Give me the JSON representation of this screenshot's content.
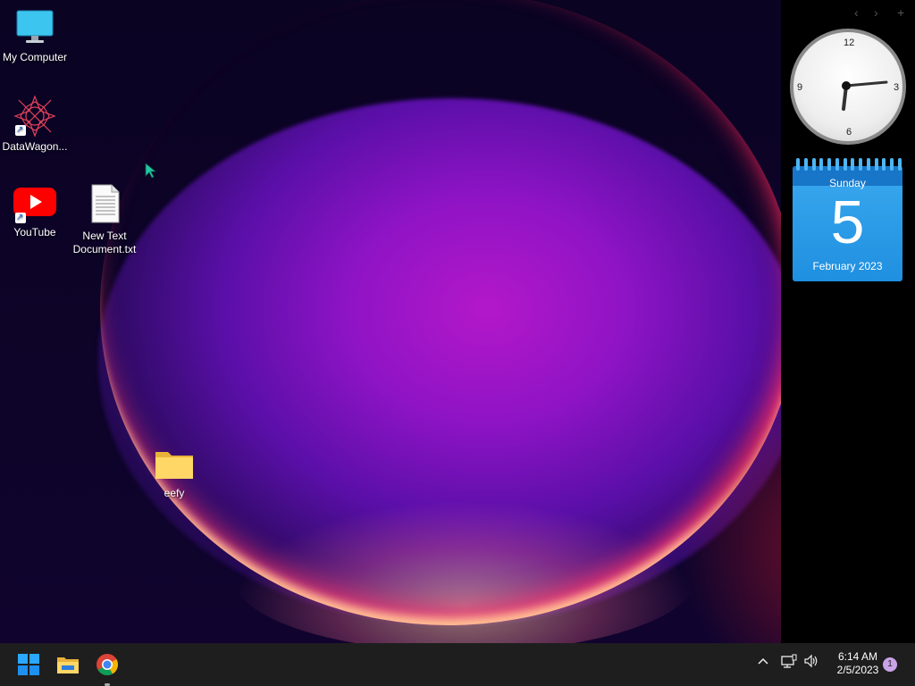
{
  "desktop": {
    "icons": [
      {
        "label": "My Computer",
        "icon": "monitor-icon"
      },
      {
        "label": "DataWagon...",
        "icon": "datawagon-icon"
      },
      {
        "label": "YouTube",
        "icon": "youtube-icon"
      },
      {
        "label": "New Text\nDocument.txt",
        "icon": "text-file-icon"
      },
      {
        "label": "eefy",
        "icon": "folder-icon"
      }
    ]
  },
  "sidebar": {
    "nav": [
      "‹",
      "›",
      "+"
    ],
    "clock": {
      "numbers": [
        "12",
        "3",
        "6",
        "9"
      ],
      "time": "6:14"
    },
    "calendar": {
      "weekday": "Sunday",
      "day": "5",
      "month_year": "February 2023"
    }
  },
  "taskbar": {
    "apps": [
      "start-icon",
      "file-explorer-icon",
      "chrome-icon"
    ],
    "tray": {
      "chevron": "^",
      "time": "6:14 AM",
      "date": "2/5/2023",
      "notifications": "1"
    }
  },
  "colors": {
    "taskbar": "#1e1e1e",
    "calendar": "#1f8fe0",
    "sidebar": "#000000"
  }
}
